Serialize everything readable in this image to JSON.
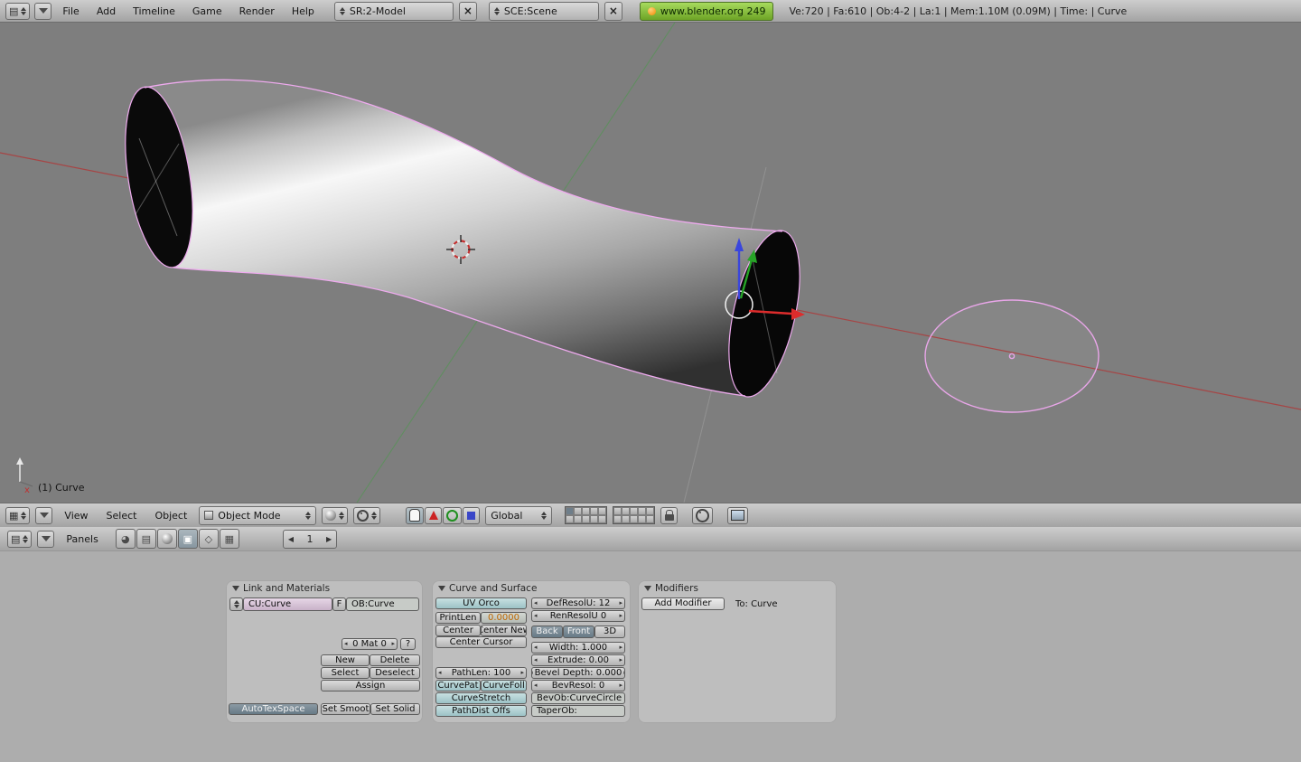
{
  "top_header": {
    "menus": [
      "File",
      "Add",
      "Timeline",
      "Game",
      "Render",
      "Help"
    ],
    "screen_selector": "SR:2-Model",
    "scene_selector": "SCE:Scene",
    "version_button": "www.blender.org 249",
    "stats": "Ve:720 | Fa:610 | Ob:4-2 | La:1 | Mem:1.10M (0.09M) | Time: | Curve"
  },
  "viewport": {
    "object_info": "(1) Curve",
    "axis_label_x": "x"
  },
  "view3d_header": {
    "menus": [
      "View",
      "Select",
      "Object"
    ],
    "mode_selector": "Object Mode",
    "orientation_selector": "Global"
  },
  "buttons_header": {
    "panels_label": "Panels",
    "frame_value": "1"
  },
  "link_panel": {
    "title": "Link and Materials",
    "cu_field": "CU:Curve",
    "fake_user_button": "F",
    "ob_field": "OB:Curve",
    "material_index": "0 Mat 0",
    "help_button": "?",
    "new_button": "New",
    "delete_button": "Delete",
    "select_button": "Select",
    "deselect_button": "Deselect",
    "assign_button": "Assign",
    "autotexspace_button": "AutoTexSpace",
    "set_smooth_button": "Set Smoot",
    "set_solid_button": "Set Solid"
  },
  "curve_panel": {
    "title": "Curve and Surface",
    "uv_orco": "UV Orco",
    "printlen": "PrintLen",
    "printlen_value": "0.0000",
    "center": "Center",
    "center_new": "Center New",
    "center_cursor": "Center Cursor",
    "pathlen": "PathLen: 100",
    "curvepath": "CurvePat",
    "curvefollow": "CurveFoll",
    "curvestretch": "CurveStretch",
    "pathdist_offs": "PathDist Offs",
    "defresolu": "DefResolU: 12",
    "renresolu": "RenResolU 0",
    "back": "Back",
    "front": "Front",
    "threed": "3D",
    "width": "Width: 1.000",
    "extrude": "Extrude: 0.00",
    "bevel_depth": "Bevel Depth: 0.000",
    "bevresol": "BevResol: 0",
    "bevob": "BevOb:CurveCircle",
    "taperob": "TaperOb:"
  },
  "modifiers_panel": {
    "title": "Modifiers",
    "add_modifier_button": "Add Modifier",
    "to_label": "To: Curve"
  },
  "icons": {
    "window_type_info": "▤",
    "window_type_3d": "▦",
    "window_type_buttons": "▤",
    "close": "×",
    "frame_prev": "◀",
    "frame_next": "▶",
    "num_left": "◂",
    "num_right": "▸",
    "context_logic": "◕",
    "context_script": "▤",
    "context_editing": "▣",
    "context_object": "◇",
    "context_scene": "▦"
  }
}
